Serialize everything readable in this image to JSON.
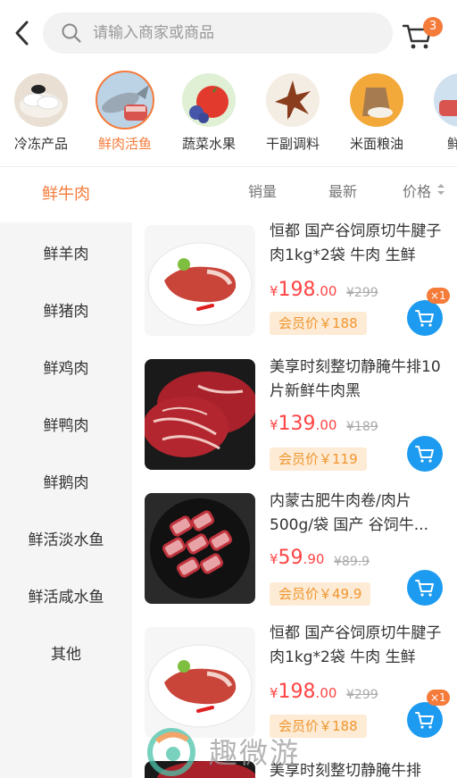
{
  "search": {
    "placeholder": "请输入商家或商品"
  },
  "cart": {
    "count": "3"
  },
  "categories": [
    {
      "label": "冷冻产品",
      "icon": "dumplings-icon"
    },
    {
      "label": "鲜肉活鱼",
      "icon": "fish-icon",
      "active": true
    },
    {
      "label": "蔬菜水果",
      "icon": "tomato-icon"
    },
    {
      "label": "干副调料",
      "icon": "star-anise-icon"
    },
    {
      "label": "米面粮油",
      "icon": "flour-sack-icon"
    },
    {
      "label": "鲜肉",
      "icon": "meat-icon"
    }
  ],
  "sidebar": {
    "items": [
      "鲜牛肉",
      "鲜羊肉",
      "鲜猪肉",
      "鲜鸡肉",
      "鲜鸭肉",
      "鲜鹅肉",
      "鲜活淡水鱼",
      "鲜活咸水鱼",
      "其他"
    ]
  },
  "sort": {
    "sales": "销量",
    "newest": "最新",
    "price": "价格"
  },
  "products": [
    {
      "name": "恒都 国产谷饲原切牛腱子肉1kg*2袋 牛肉 生鲜",
      "currency": "¥",
      "price_int": "198",
      "price_dec": ".00",
      "old_price": "¥299",
      "member": "会员价￥188",
      "qty": "×1"
    },
    {
      "name": "美享时刻整切静腌牛排10片新鲜牛肉黑",
      "currency": "¥",
      "price_int": "139",
      "price_dec": ".00",
      "old_price": "¥189",
      "member": "会员价￥119"
    },
    {
      "name": "内蒙古肥牛肉卷/肉片500g/袋 国产 谷饲牛...",
      "currency": "¥",
      "price_int": "59",
      "price_dec": ".90",
      "old_price": "¥89.9",
      "member": "会员价￥49.9"
    },
    {
      "name": "恒都 国产谷饲原切牛腱子肉1kg*2袋 牛肉 生鲜",
      "currency": "¥",
      "price_int": "198",
      "price_dec": ".00",
      "old_price": "¥299",
      "member": "会员价￥188",
      "qty": "×1"
    },
    {
      "name": "美享时刻整切静腌牛排"
    }
  ],
  "watermark": {
    "text": "趣微游"
  },
  "colors": {
    "accent": "#f47b3a",
    "price": "#ff4444",
    "cart_button": "#1d9bf0",
    "member_bg": "#fdebd5"
  }
}
